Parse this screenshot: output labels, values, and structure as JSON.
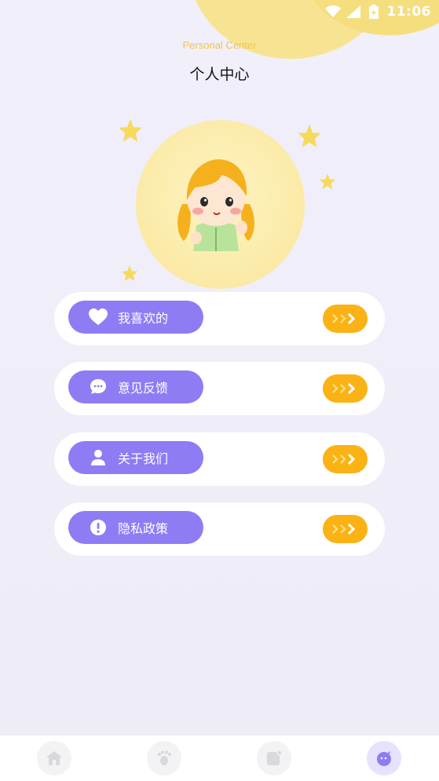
{
  "status_bar": {
    "time": "11:06",
    "icons": [
      "wifi-icon",
      "signal-icon",
      "battery-icon"
    ]
  },
  "header": {
    "subtitle": "Personal Center",
    "title": "个人中心"
  },
  "avatar": {
    "description_icon": "girl-avatar"
  },
  "menu": [
    {
      "label": "我喜欢的",
      "icon": "heart-icon"
    },
    {
      "label": "意见反馈",
      "icon": "chat-bubble-icon"
    },
    {
      "label": "关于我们",
      "icon": "person-icon"
    },
    {
      "label": "隐私政策",
      "icon": "alert-icon"
    }
  ],
  "bottom_nav": [
    {
      "name": "home",
      "icon": "home-icon",
      "active": false
    },
    {
      "name": "footprint",
      "icon": "footprint-icon",
      "active": false
    },
    {
      "name": "note",
      "icon": "note-icon",
      "active": false
    },
    {
      "name": "profile",
      "icon": "profile-face-icon",
      "active": true
    }
  ],
  "colors": {
    "accent": "#8e7cf4",
    "go": "#fbb214",
    "moon": "#f7e493",
    "subtitle": "#f3c34d"
  }
}
